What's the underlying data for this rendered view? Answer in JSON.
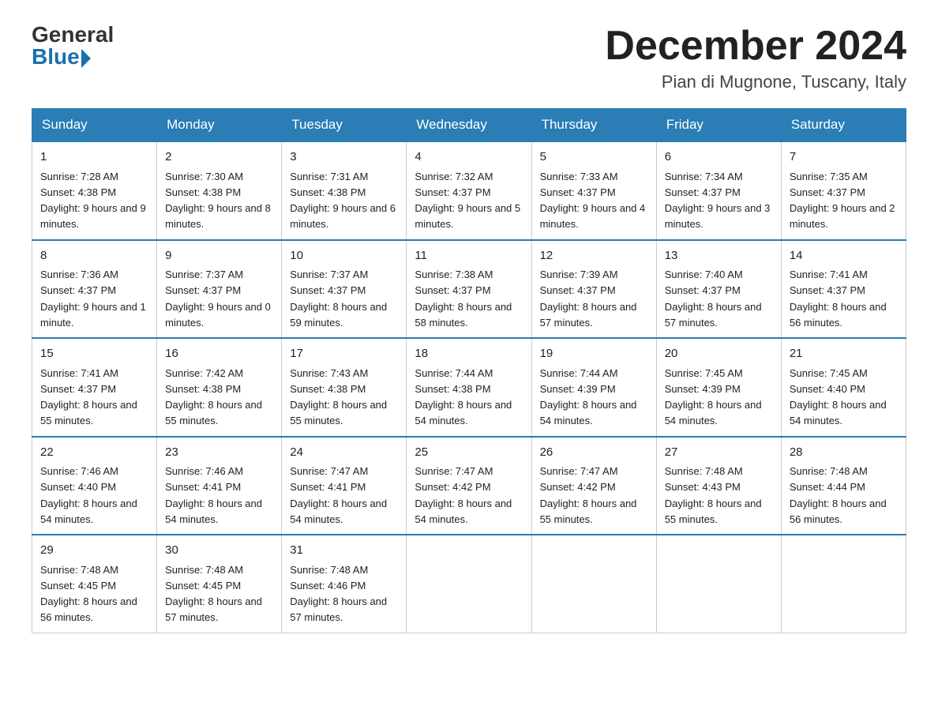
{
  "logo": {
    "general": "General",
    "blue": "Blue"
  },
  "header": {
    "month_year": "December 2024",
    "location": "Pian di Mugnone, Tuscany, Italy"
  },
  "days_of_week": [
    "Sunday",
    "Monday",
    "Tuesday",
    "Wednesday",
    "Thursday",
    "Friday",
    "Saturday"
  ],
  "weeks": [
    [
      {
        "day": "1",
        "sunrise": "7:28 AM",
        "sunset": "4:38 PM",
        "daylight": "9 hours and 9 minutes."
      },
      {
        "day": "2",
        "sunrise": "7:30 AM",
        "sunset": "4:38 PM",
        "daylight": "9 hours and 8 minutes."
      },
      {
        "day": "3",
        "sunrise": "7:31 AM",
        "sunset": "4:38 PM",
        "daylight": "9 hours and 6 minutes."
      },
      {
        "day": "4",
        "sunrise": "7:32 AM",
        "sunset": "4:37 PM",
        "daylight": "9 hours and 5 minutes."
      },
      {
        "day": "5",
        "sunrise": "7:33 AM",
        "sunset": "4:37 PM",
        "daylight": "9 hours and 4 minutes."
      },
      {
        "day": "6",
        "sunrise": "7:34 AM",
        "sunset": "4:37 PM",
        "daylight": "9 hours and 3 minutes."
      },
      {
        "day": "7",
        "sunrise": "7:35 AM",
        "sunset": "4:37 PM",
        "daylight": "9 hours and 2 minutes."
      }
    ],
    [
      {
        "day": "8",
        "sunrise": "7:36 AM",
        "sunset": "4:37 PM",
        "daylight": "9 hours and 1 minute."
      },
      {
        "day": "9",
        "sunrise": "7:37 AM",
        "sunset": "4:37 PM",
        "daylight": "9 hours and 0 minutes."
      },
      {
        "day": "10",
        "sunrise": "7:37 AM",
        "sunset": "4:37 PM",
        "daylight": "8 hours and 59 minutes."
      },
      {
        "day": "11",
        "sunrise": "7:38 AM",
        "sunset": "4:37 PM",
        "daylight": "8 hours and 58 minutes."
      },
      {
        "day": "12",
        "sunrise": "7:39 AM",
        "sunset": "4:37 PM",
        "daylight": "8 hours and 57 minutes."
      },
      {
        "day": "13",
        "sunrise": "7:40 AM",
        "sunset": "4:37 PM",
        "daylight": "8 hours and 57 minutes."
      },
      {
        "day": "14",
        "sunrise": "7:41 AM",
        "sunset": "4:37 PM",
        "daylight": "8 hours and 56 minutes."
      }
    ],
    [
      {
        "day": "15",
        "sunrise": "7:41 AM",
        "sunset": "4:37 PM",
        "daylight": "8 hours and 55 minutes."
      },
      {
        "day": "16",
        "sunrise": "7:42 AM",
        "sunset": "4:38 PM",
        "daylight": "8 hours and 55 minutes."
      },
      {
        "day": "17",
        "sunrise": "7:43 AM",
        "sunset": "4:38 PM",
        "daylight": "8 hours and 55 minutes."
      },
      {
        "day": "18",
        "sunrise": "7:44 AM",
        "sunset": "4:38 PM",
        "daylight": "8 hours and 54 minutes."
      },
      {
        "day": "19",
        "sunrise": "7:44 AM",
        "sunset": "4:39 PM",
        "daylight": "8 hours and 54 minutes."
      },
      {
        "day": "20",
        "sunrise": "7:45 AM",
        "sunset": "4:39 PM",
        "daylight": "8 hours and 54 minutes."
      },
      {
        "day": "21",
        "sunrise": "7:45 AM",
        "sunset": "4:40 PM",
        "daylight": "8 hours and 54 minutes."
      }
    ],
    [
      {
        "day": "22",
        "sunrise": "7:46 AM",
        "sunset": "4:40 PM",
        "daylight": "8 hours and 54 minutes."
      },
      {
        "day": "23",
        "sunrise": "7:46 AM",
        "sunset": "4:41 PM",
        "daylight": "8 hours and 54 minutes."
      },
      {
        "day": "24",
        "sunrise": "7:47 AM",
        "sunset": "4:41 PM",
        "daylight": "8 hours and 54 minutes."
      },
      {
        "day": "25",
        "sunrise": "7:47 AM",
        "sunset": "4:42 PM",
        "daylight": "8 hours and 54 minutes."
      },
      {
        "day": "26",
        "sunrise": "7:47 AM",
        "sunset": "4:42 PM",
        "daylight": "8 hours and 55 minutes."
      },
      {
        "day": "27",
        "sunrise": "7:48 AM",
        "sunset": "4:43 PM",
        "daylight": "8 hours and 55 minutes."
      },
      {
        "day": "28",
        "sunrise": "7:48 AM",
        "sunset": "4:44 PM",
        "daylight": "8 hours and 56 minutes."
      }
    ],
    [
      {
        "day": "29",
        "sunrise": "7:48 AM",
        "sunset": "4:45 PM",
        "daylight": "8 hours and 56 minutes."
      },
      {
        "day": "30",
        "sunrise": "7:48 AM",
        "sunset": "4:45 PM",
        "daylight": "8 hours and 57 minutes."
      },
      {
        "day": "31",
        "sunrise": "7:48 AM",
        "sunset": "4:46 PM",
        "daylight": "8 hours and 57 minutes."
      },
      null,
      null,
      null,
      null
    ]
  ],
  "labels": {
    "sunrise": "Sunrise:",
    "sunset": "Sunset:",
    "daylight": "Daylight:"
  }
}
